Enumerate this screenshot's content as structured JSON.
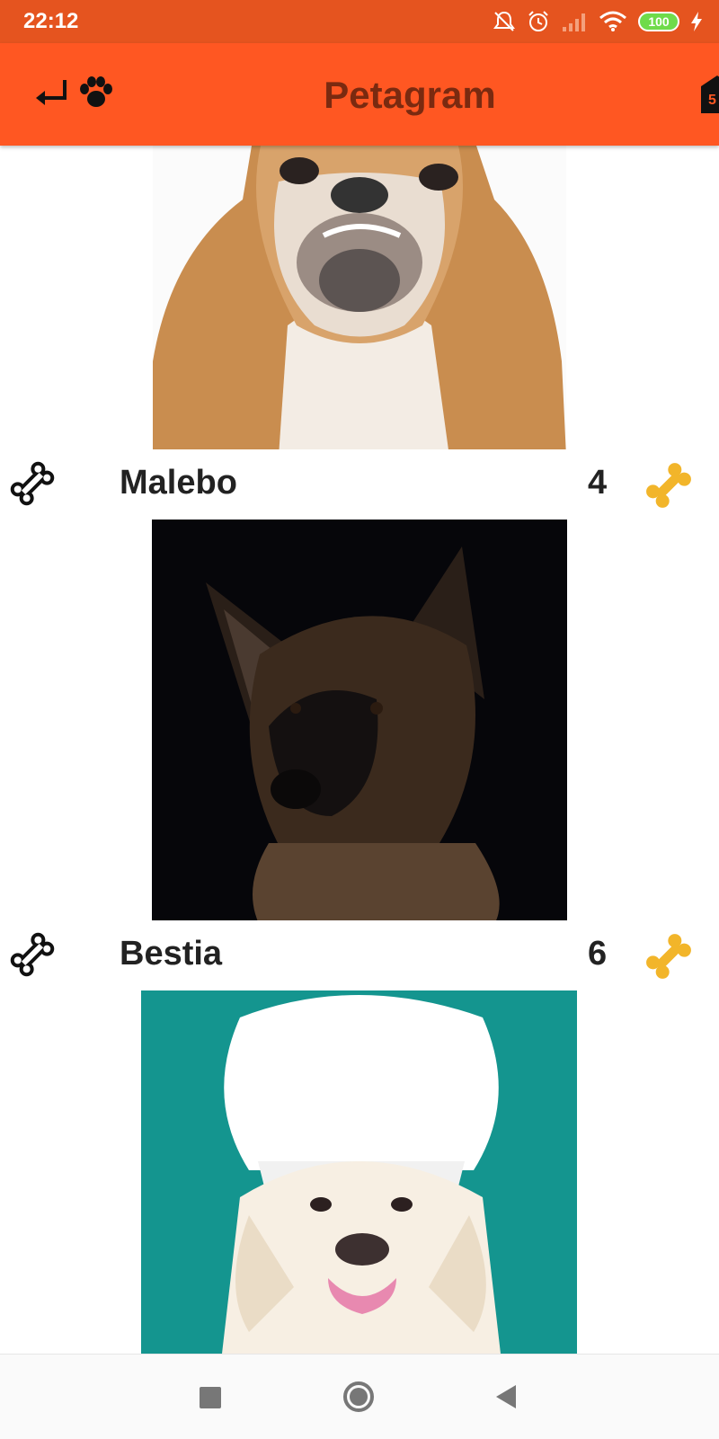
{
  "status_bar": {
    "time": "22:12",
    "battery": "100",
    "icons": [
      "mute-icon",
      "alarm-icon",
      "signal-icon",
      "wifi-icon",
      "battery-icon",
      "charging-icon"
    ]
  },
  "app_bar": {
    "title": "Petagram",
    "left_icons": [
      "return-arrow-icon",
      "paw-icon"
    ],
    "right_icon": "star-rating-icon",
    "colors": {
      "status": "#E5541F",
      "toolbar": "#FF5722",
      "title": "#7A2A10"
    }
  },
  "pets": [
    {
      "name": "Malebo",
      "likes": "4",
      "photo": "bulldog"
    },
    {
      "name": "Bestia",
      "likes": "6",
      "photo": "german-shepherd"
    },
    {
      "name": "",
      "likes": "",
      "photo": "golden-retriever-chef-hat"
    }
  ],
  "nav_bar": [
    "recent-apps-button",
    "home-button",
    "back-button"
  ]
}
